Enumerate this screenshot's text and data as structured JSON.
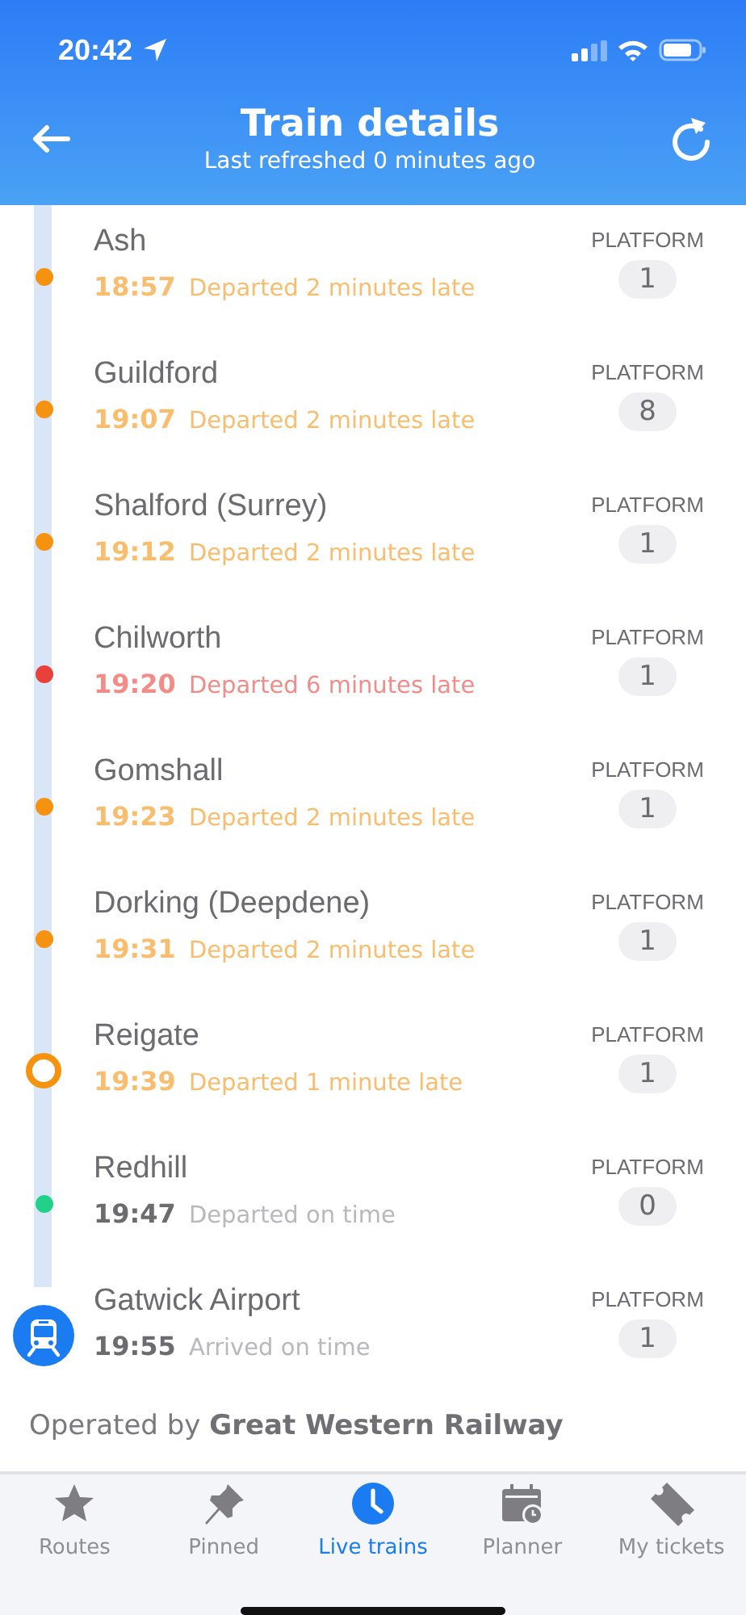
{
  "status_bar": {
    "time": "20:42"
  },
  "header": {
    "title": "Train details",
    "subtitle": "Last refreshed 0 minutes ago"
  },
  "stops": [
    {
      "name": "Ash",
      "time": "18:57",
      "status_text": "Departed 2 minutes late",
      "late": true,
      "kind": "dot",
      "color": "#f5920f",
      "platform_label": "PLATFORM",
      "platform": "1"
    },
    {
      "name": "Guildford",
      "time": "19:07",
      "status_text": "Departed 2 minutes late",
      "late": true,
      "kind": "dot",
      "color": "#f5920f",
      "platform_label": "PLATFORM",
      "platform": "8"
    },
    {
      "name": "Shalford (Surrey)",
      "time": "19:12",
      "status_text": "Departed 2 minutes late",
      "late": true,
      "kind": "dot",
      "color": "#f5920f",
      "platform_label": "PLATFORM",
      "platform": "1"
    },
    {
      "name": "Chilworth",
      "time": "19:20",
      "status_text": "Departed 6 minutes late",
      "late": true,
      "kind": "dot",
      "color": "#e8413c",
      "platform_label": "PLATFORM",
      "platform": "1"
    },
    {
      "name": "Gomshall",
      "time": "19:23",
      "status_text": "Departed 2 minutes late",
      "late": true,
      "kind": "dot",
      "color": "#f5920f",
      "platform_label": "PLATFORM",
      "platform": "1"
    },
    {
      "name": "Dorking (Deepdene)",
      "time": "19:31",
      "status_text": "Departed 2 minutes late",
      "late": true,
      "kind": "dot",
      "color": "#f5920f",
      "platform_label": "PLATFORM",
      "platform": "1"
    },
    {
      "name": "Reigate",
      "time": "19:39",
      "status_text": "Departed 1 minute late",
      "late": true,
      "kind": "ring",
      "color": "#f5920f",
      "platform_label": "PLATFORM",
      "platform": "1"
    },
    {
      "name": "Redhill",
      "time": "19:47",
      "status_text": "Departed on time",
      "late": false,
      "kind": "dot",
      "color": "#22d08a",
      "platform_label": "PLATFORM",
      "platform": "0"
    },
    {
      "name": "Gatwick Airport",
      "time": "19:55",
      "status_text": "Arrived on time",
      "late": false,
      "kind": "train",
      "color": "#1a7cf0",
      "platform_label": "PLATFORM",
      "platform": "1"
    }
  ],
  "operator": "Operated by **Great Western Railway**",
  "tabs": [
    {
      "label": "Routes",
      "selected": false
    },
    {
      "label": "Pinned",
      "selected": false
    },
    {
      "label": "Live trains",
      "selected": true
    },
    {
      "label": "Planner",
      "selected": false
    },
    {
      "label": "My tickets",
      "selected": false
    }
  ]
}
